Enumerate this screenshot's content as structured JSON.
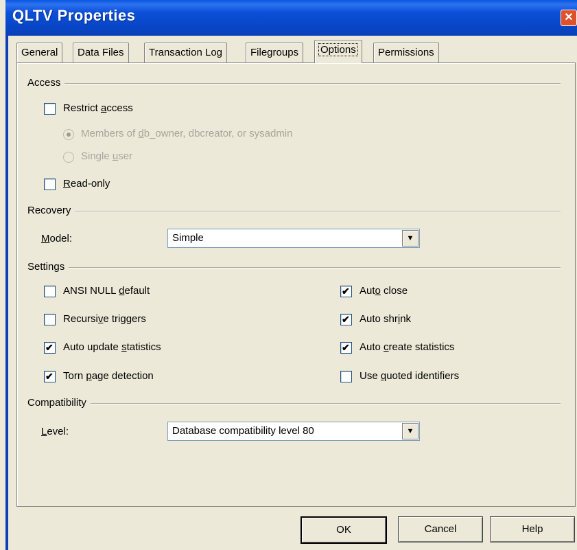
{
  "window": {
    "title": "QLTV Properties",
    "close_glyph": "✕"
  },
  "tabs": [
    {
      "label": "General"
    },
    {
      "label": "Data Files"
    },
    {
      "label": "Transaction Log"
    },
    {
      "label": "Filegroups"
    },
    {
      "label": "Options",
      "active": true
    },
    {
      "label": "Permissions"
    }
  ],
  "access": {
    "group": "Access",
    "restrict": {
      "pre": "Restrict ",
      "ul": "a",
      "post": "ccess",
      "checked": false
    },
    "members": {
      "pre": "Members of ",
      "ul": "d",
      "post": "b_owner, dbcreator, or sysadmin",
      "selected": true,
      "enabled": false
    },
    "single": {
      "pre": "Single ",
      "ul": "u",
      "post": "ser",
      "selected": false,
      "enabled": false
    },
    "readonly": {
      "pre": "",
      "ul": "R",
      "post": "ead-only",
      "checked": false
    }
  },
  "recovery": {
    "group": "Recovery",
    "model": {
      "pre": "",
      "ul": "M",
      "post": "odel:"
    },
    "value": "Simple"
  },
  "settings": {
    "group": "Settings",
    "ansi_null": {
      "pre": "ANSI NULL ",
      "ul": "d",
      "post": "efault",
      "checked": false
    },
    "recursive": {
      "pre": "Recursi",
      "ul": "v",
      "post": "e triggers",
      "checked": false
    },
    "auto_update": {
      "pre": "Auto update ",
      "ul": "s",
      "post": "tatistics",
      "checked": true
    },
    "torn_page": {
      "pre": "Torn ",
      "ul": "p",
      "post": "age detection",
      "checked": true
    },
    "auto_close": {
      "pre": "Aut",
      "ul": "o",
      "post": " close",
      "checked": true
    },
    "auto_shrink": {
      "pre": "Auto shr",
      "ul": "i",
      "post": "nk",
      "checked": true
    },
    "auto_create": {
      "pre": "Auto ",
      "ul": "c",
      "post": "reate statistics",
      "checked": true
    },
    "quoted": {
      "pre": "Use ",
      "ul": "q",
      "post": "uoted identifiers",
      "checked": false
    }
  },
  "compat": {
    "group": "Compatibility",
    "level": {
      "pre": "",
      "ul": "L",
      "post": "evel:"
    },
    "value": "Database compatibility level 80"
  },
  "buttons": {
    "ok": "OK",
    "cancel": "Cancel",
    "help": "Help"
  }
}
